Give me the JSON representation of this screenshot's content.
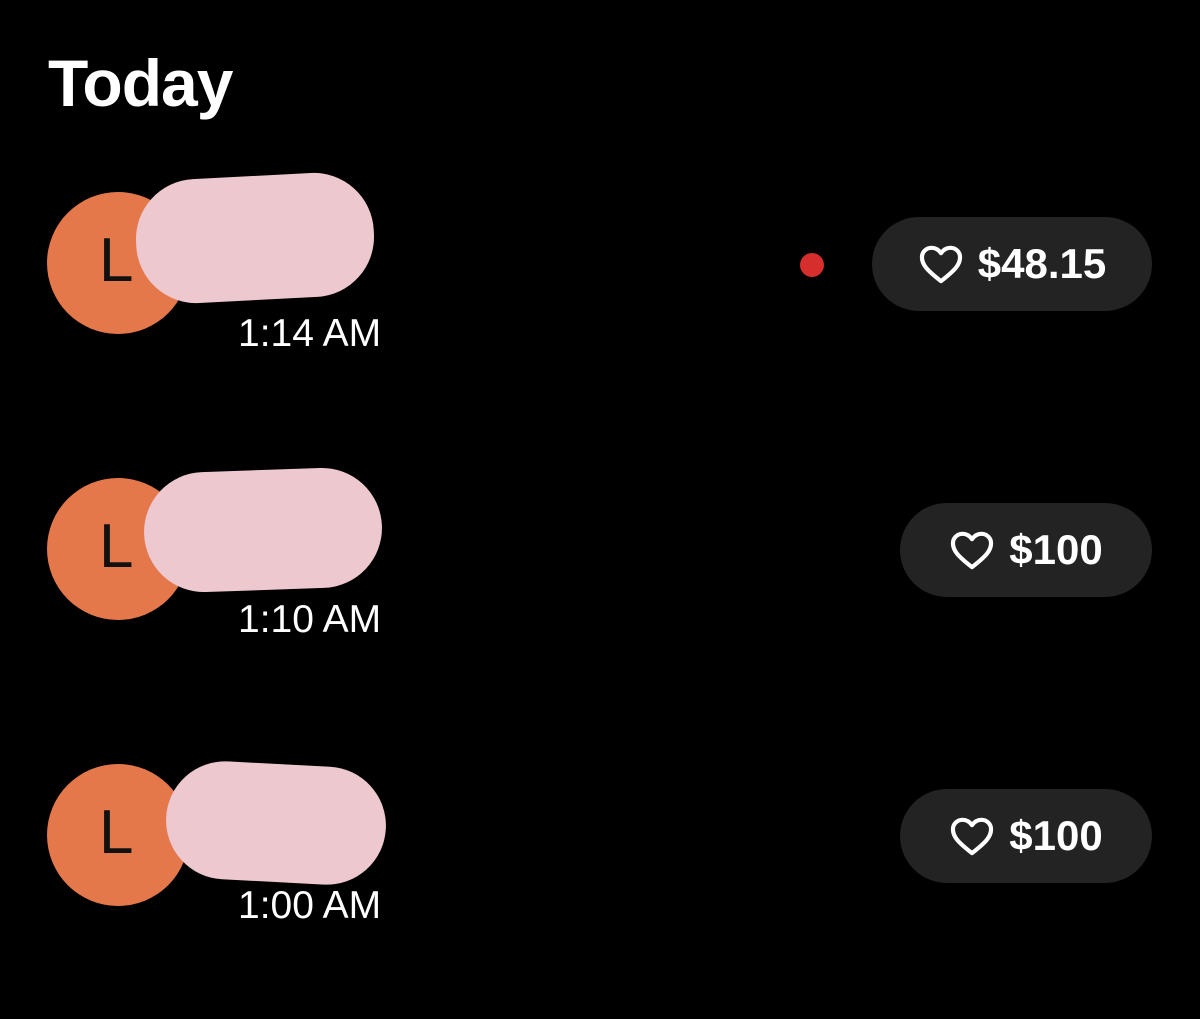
{
  "section": {
    "title": "Today"
  },
  "colors": {
    "background": "#000000",
    "avatar": "#e5784a",
    "pill": "#232323",
    "unread_dot": "#d62d2d",
    "redaction": "#edc8cf"
  },
  "transactions": [
    {
      "avatar_letter": "L",
      "time": "1:14 AM",
      "amount": "$48.15",
      "unread": true,
      "icon": "heart-outline-icon"
    },
    {
      "avatar_letter": "L",
      "time": "1:10 AM",
      "amount": "$100",
      "unread": false,
      "icon": "heart-outline-icon"
    },
    {
      "avatar_letter": "L",
      "time": "1:00 AM",
      "amount": "$100",
      "unread": false,
      "icon": "heart-outline-icon"
    }
  ]
}
